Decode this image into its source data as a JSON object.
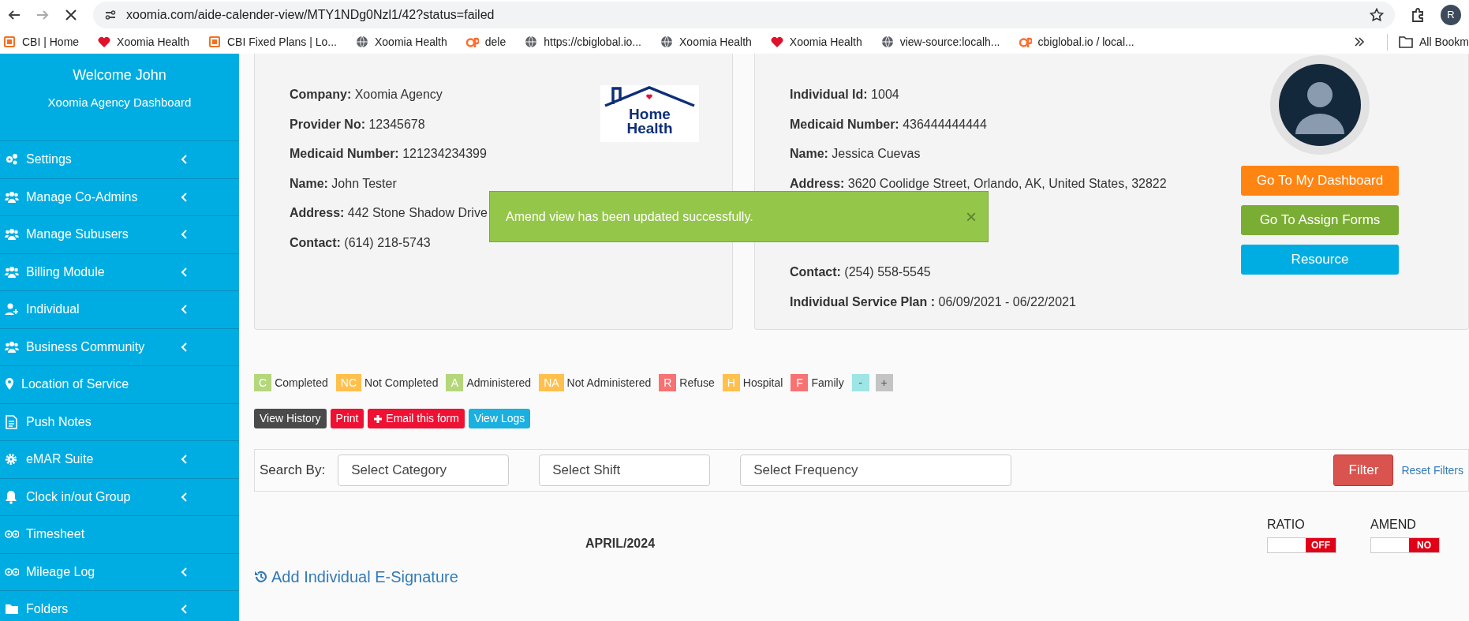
{
  "browser": {
    "url": "xoomia.com/aide-calender-view/MTY1NDg0Nzl1/42?status=failed",
    "profile": "R",
    "bookmarks": [
      {
        "label": "CBI | Home",
        "kind": "box"
      },
      {
        "label": "Xoomia Health",
        "kind": "heart"
      },
      {
        "label": "CBI Fixed Plans | Lo...",
        "kind": "box"
      },
      {
        "label": "Xoomia Health",
        "kind": "globe"
      },
      {
        "label": "dele",
        "kind": "cp"
      },
      {
        "label": "https://cbiglobal.io...",
        "kind": "globe"
      },
      {
        "label": "Xoomia Health",
        "kind": "globe"
      },
      {
        "label": "Xoomia Health",
        "kind": "heart"
      },
      {
        "label": "view-source:localh...",
        "kind": "globe"
      },
      {
        "label": "cbiglobal.io / local...",
        "kind": "cp"
      }
    ],
    "all_bookmarks": "All Bookm"
  },
  "sidebar": {
    "welcome": "Welcome John",
    "subtitle": "Xoomia Agency Dashboard",
    "items": [
      {
        "label": "Settings",
        "kind": "gears",
        "submenu": true
      },
      {
        "label": "Manage Co-Admins",
        "kind": "users",
        "submenu": true
      },
      {
        "label": "Manage Subusers",
        "kind": "users",
        "submenu": true
      },
      {
        "label": "Billing Module",
        "kind": "users",
        "submenu": true
      },
      {
        "label": "Individual",
        "kind": "user-plus",
        "submenu": true
      },
      {
        "label": "Business Community",
        "kind": "users",
        "submenu": true
      },
      {
        "label": "Location of Service",
        "kind": "pin",
        "submenu": false
      },
      {
        "label": "Push Notes",
        "kind": "doc",
        "submenu": false
      },
      {
        "label": "eMAR Suite",
        "kind": "gear",
        "submenu": true
      },
      {
        "label": "Clock in/out Group",
        "kind": "bell",
        "submenu": true
      },
      {
        "label": "Timesheet",
        "kind": "owl",
        "submenu": false
      },
      {
        "label": "Mileage Log",
        "kind": "owl",
        "submenu": true
      },
      {
        "label": "Folders",
        "kind": "folder",
        "submenu": true
      }
    ]
  },
  "company_card": {
    "fields": [
      {
        "label": "Company:",
        "value": "Xoomia Agency"
      },
      {
        "label": "Provider No:",
        "value": "12345678"
      },
      {
        "label": "Medicaid Number:",
        "value": "121234234399"
      },
      {
        "label": "Name:",
        "value": "John Tester"
      },
      {
        "label": "Address:",
        "value": "442 Stone Shadow Drive"
      },
      {
        "label": "Contact:",
        "value": "(614) 218-5743"
      }
    ],
    "logo": {
      "line1": "Home",
      "line2": "Health"
    }
  },
  "individual_card": {
    "fields": [
      {
        "label": "Individual Id:",
        "value": "1004"
      },
      {
        "label": "Medicaid Number:",
        "value": "436444444444"
      },
      {
        "label": "Name:",
        "value": "Jessica Cuevas"
      },
      {
        "label": "Address:",
        "value": "3620 Coolidge Street, Orlando, AK, United States, 32822"
      },
      {
        "label": "Contact:",
        "value": "(254) 558-5545"
      },
      {
        "label": "Individual Service Plan :",
        "value": "06/09/2021 - 06/22/2021"
      }
    ],
    "buttons": [
      {
        "label": "Go To My Dashboard",
        "color": "#ff8512"
      },
      {
        "label": "Go To Assign Forms",
        "color": "#7aad34"
      },
      {
        "label": "Resource",
        "color": "#00ade2"
      }
    ]
  },
  "toast": {
    "message": "Amend view has been updated successfully.",
    "close": "×"
  },
  "legend": [
    {
      "code": "C",
      "label": "Completed",
      "color": "#b5d77b"
    },
    {
      "code": "NC",
      "label": "Not Completed",
      "color": "#ffc04d"
    },
    {
      "code": "A",
      "label": "Administered",
      "color": "#b5d77b"
    },
    {
      "code": "NA",
      "label": "Not Administered",
      "color": "#ffc04d"
    },
    {
      "code": "R",
      "label": "Refuse",
      "color": "#f77373"
    },
    {
      "code": "H",
      "label": "Hospital",
      "color": "#ffc04d"
    },
    {
      "code": "F",
      "label": "Family",
      "color": "#f77373"
    },
    {
      "code": "-",
      "color": "#9ee5e5"
    },
    {
      "code": "+",
      "color": "#c4c4c4"
    }
  ],
  "actions": [
    {
      "label": "View History",
      "color": "#4a4a4a"
    },
    {
      "label": "Print",
      "color": "#ee1133"
    },
    {
      "label": "Email this form",
      "color": "#ee1133",
      "kind": "plus"
    },
    {
      "label": "View Logs",
      "color": "#1ab0e0"
    }
  ],
  "search": {
    "label": "Search By:",
    "selects": [
      "Select Category",
      "Select Shift",
      "Select Frequency"
    ],
    "filter": "Filter",
    "reset": "Reset Filters"
  },
  "month": "APRIL/2024",
  "toggles": [
    {
      "label": "RATIO",
      "on": false,
      "text": "OFF"
    },
    {
      "label": "AMEND",
      "on": false,
      "text": "NO"
    }
  ],
  "signature_link": "Add Individual E-Signature"
}
